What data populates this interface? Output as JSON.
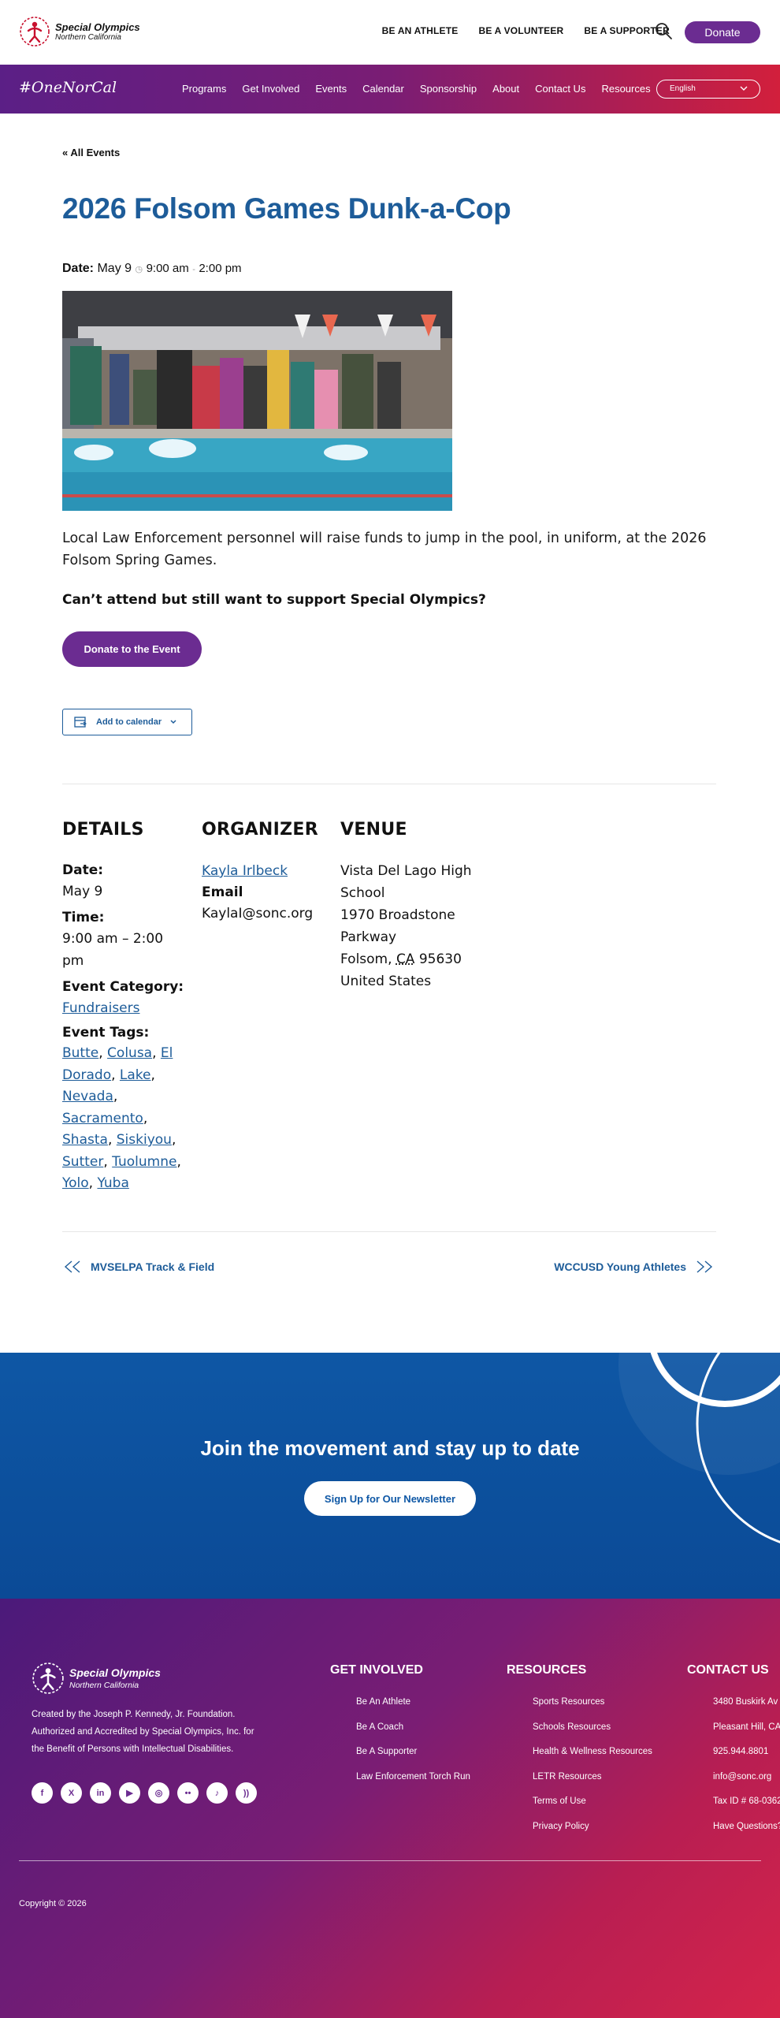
{
  "header": {
    "logo_line1": "Special Olympics",
    "logo_line2": "Northern California",
    "nav": [
      "BE AN ATHLETE",
      "BE A VOLUNTEER",
      "BE A SUPPORTER"
    ],
    "donate_label": "Donate"
  },
  "navbar": {
    "hashtag": "#OneNorCal",
    "items": [
      "Programs",
      "Get Involved",
      "Events",
      "Calendar",
      "Sponsorship",
      "About",
      "Contact Us",
      "Resources"
    ],
    "language": "English"
  },
  "event": {
    "back_link": "« All Events",
    "title": "2026 Folsom Games Dunk-a-Cop",
    "date_label": "Date:",
    "date_value": "May 9",
    "time_start": "9:00 am",
    "time_sep": "-",
    "time_end": "2:00 pm",
    "description": "Local Law Enforcement personnel will raise funds to jump in the pool, in uniform, at the 2026 Folsom Spring Games.",
    "support_question": "Can’t attend but still want to support Special Olympics?",
    "donate_event_label": "Donate to the Event",
    "add_calendar_label": "Add to calendar"
  },
  "details": {
    "heading": "DETAILS",
    "date_label": "Date:",
    "date_value": "May 9",
    "time_label": "Time:",
    "time_value": "9:00 am – 2:00 pm",
    "category_label": "Event Category:",
    "category_value": "Fundraisers",
    "tags_label": "Event Tags:",
    "tags": [
      "Butte",
      "Colusa",
      "El Dorado",
      "Lake",
      "Nevada",
      "Sacramento",
      "Shasta",
      "Siskiyou",
      "Sutter",
      "Tuolumne",
      "Yolo",
      "Yuba"
    ]
  },
  "organizer": {
    "heading": "ORGANIZER",
    "name": "Kayla Irlbeck",
    "email_label": "Email",
    "email_value": "KaylaI@sonc.org"
  },
  "venue": {
    "heading": "VENUE",
    "name_line1": "Vista Del Lago High",
    "name_line2": "School",
    "address_line1": "1970 Broadstone",
    "address_line2": "Parkway",
    "city": "Folsom,",
    "state": "CA",
    "zip": "95630",
    "country": "United States"
  },
  "pager": {
    "prev": "MVSELPA Track & Field",
    "next": "WCCUSD Young Athletes"
  },
  "newsletter": {
    "title": "Join the movement and stay up to date",
    "button": "Sign Up for Our Newsletter"
  },
  "footer": {
    "logo_line1": "Special Olympics",
    "logo_line2": "Northern California",
    "desc_line1": "Created by the Joseph P. Kennedy, Jr. Foundation.",
    "desc_line2": "Authorized and Accredited by Special Olympics, Inc. for",
    "desc_line3": "the Benefit of Persons with Intellectual Disabilities.",
    "social": [
      "facebook-icon",
      "x-icon",
      "linkedin-icon",
      "youtube-icon",
      "instagram-icon",
      "flickr-icon",
      "tiktok-icon",
      "rss-icon"
    ],
    "col1": {
      "heading": "GET INVOLVED",
      "items": [
        "Be An Athlete",
        "Be A Coach",
        "Be A Supporter",
        "Law Enforcement Torch Run"
      ]
    },
    "col2": {
      "heading": "RESOURCES",
      "items": [
        "Sports Resources",
        "Schools Resources",
        "Health & Wellness Resources",
        "LETR Resources",
        "Terms of Use",
        "Privacy Policy"
      ]
    },
    "col3": {
      "heading": "CONTACT US",
      "items": [
        "3480 Buskirk Av",
        "Pleasant Hill, CA",
        "925.944.8801",
        "info@sonc.org",
        "Tax ID # 68-0362",
        "Have Questions?"
      ]
    },
    "copyright": "Copyright © 2026"
  },
  "colors": {
    "purple": "#6b2c91",
    "link_blue": "#1d5c99",
    "newsletter_blue": "#0e57a5",
    "footer_red": "#d6244a"
  }
}
